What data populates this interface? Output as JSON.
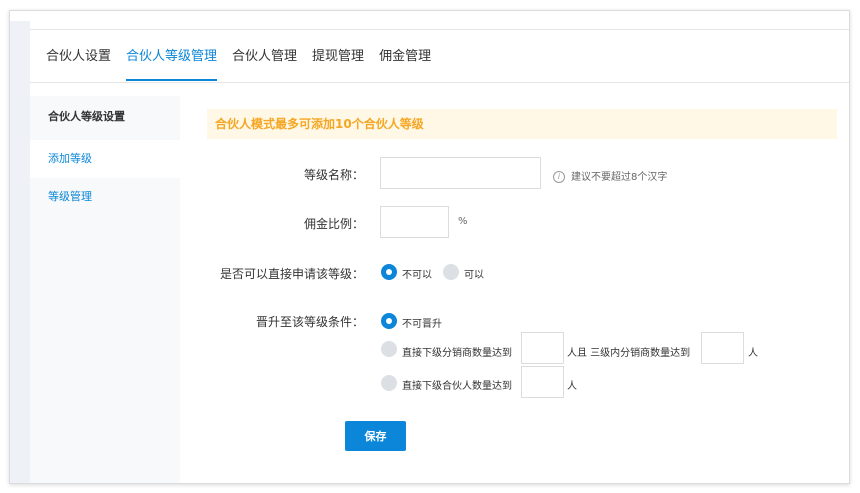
{
  "tabs": [
    "合伙人设置",
    "合伙人等级管理",
    "合伙人管理",
    "提现管理",
    "佣金管理"
  ],
  "sidebar": {
    "title": "合伙人等级设置",
    "items": [
      {
        "label": "添加等级"
      },
      {
        "label": "等级管理"
      }
    ]
  },
  "notice": "合伙人模式最多可添加10个合伙人等级",
  "form": {
    "name_label": "等级名称：",
    "name_value": "",
    "name_hint": "建议不要超过8个汉字",
    "commission_label": "佣金比例：",
    "commission_value": "",
    "commission_unit": "%",
    "apply_label": "是否可以直接申请该等级：",
    "apply_options": [
      "不可以",
      "可以"
    ],
    "apply_selected": "不可以",
    "upgrade_label": "晋升至该等级条件：",
    "upgrade_option_none": "不可晋升",
    "upgrade_option_dist_prefix": "直接下级分销商数量达到",
    "upgrade_option_dist_mid": "人且 三级内分销商数量达到",
    "upgrade_option_dist_suffix": "人",
    "upgrade_option_partner_prefix": "直接下级合伙人数量达到",
    "upgrade_option_partner_suffix": "人",
    "upgrade_selected": "不可晋升"
  },
  "save_label": "保存",
  "colors": {
    "accent": "#0b86d8",
    "notice_text": "#f5a623",
    "notice_bg": "#fff8e6"
  },
  "icons": {
    "hint": "info-icon"
  }
}
